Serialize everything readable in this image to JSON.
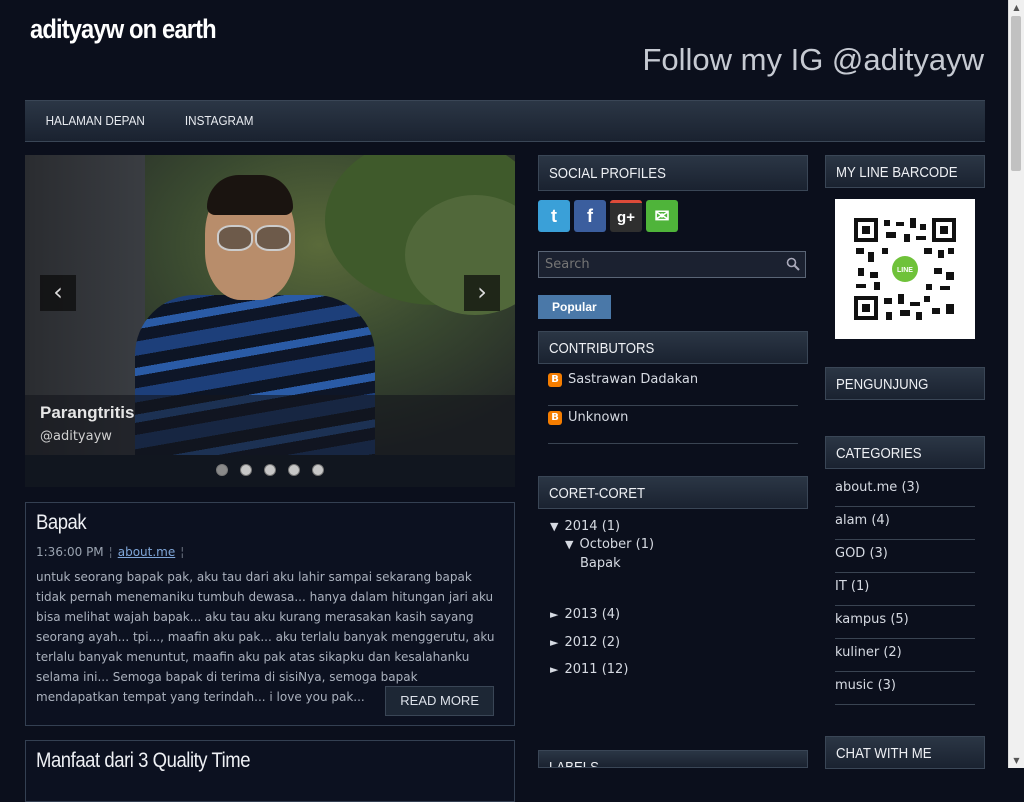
{
  "header": {
    "title": "adityayw on earth",
    "tagline": "Follow my IG @adityayw"
  },
  "nav": {
    "items": [
      "HALAMAN DEPAN",
      "INSTAGRAM"
    ]
  },
  "slider": {
    "caption_title": "Parangtritis",
    "caption_sub": "@adityayw",
    "prev": "‹",
    "next": "›",
    "dots": 5,
    "active_dot": 1
  },
  "posts": [
    {
      "title": "Bapak",
      "time": "1:36:00 PM",
      "label": "about.me",
      "excerpt": "untuk seorang bapak pak, aku tau dari aku lahir sampai sekarang bapak tidak pernah menemaniku tumbuh dewasa... hanya dalam hitungan jari aku bisa melihat wajah bapak... aku tau aku kurang merasakan kasih sayang seorang ayah... tpi..., maafin aku pak... aku terlalu banyak menggerutu, aku terlalu banyak menuntut, maafin aku pak atas sikapku dan kesalahanku selama ini... Semoga bapak di terima di sisiNya, semoga bapak mendapatkan tempat yang terindah... i love you pak...",
      "read_more": "READ MORE"
    },
    {
      "title": "Manfaat dari 3 Quality Time"
    }
  ],
  "social_profiles": {
    "title": "SOCIAL PROFILES",
    "icons": [
      {
        "name": "twitter-icon",
        "glyph": "t",
        "color": "#3aa0d8"
      },
      {
        "name": "facebook-icon",
        "glyph": "f",
        "color": "#3b5e9e"
      },
      {
        "name": "google-plus-icon",
        "glyph": "g+",
        "color": "#2f2f2f"
      },
      {
        "name": "email-icon",
        "glyph": "✉",
        "color": "#4fb43a"
      }
    ]
  },
  "search": {
    "placeholder": "Search"
  },
  "popular": {
    "label": "Popular"
  },
  "contributors": {
    "title": "CONTRIBUTORS",
    "items": [
      "Sastrawan Dadakan",
      "Unknown"
    ]
  },
  "archive": {
    "title": "CORET-CORET",
    "expanded_year": {
      "label": "2014",
      "count": "(1)"
    },
    "expanded_month": {
      "label": "October",
      "count": "(1)"
    },
    "post": "Bapak",
    "years": [
      {
        "label": "2013",
        "count": "(4)"
      },
      {
        "label": "2012",
        "count": "(2)"
      },
      {
        "label": "2011",
        "count": "(12)"
      }
    ]
  },
  "labels_widget": {
    "title": "LABELS"
  },
  "line_barcode": {
    "title": "MY LINE BARCODE",
    "logo": "LINE"
  },
  "pengunjung": {
    "title": "PENGUNJUNG"
  },
  "categories": {
    "title": "CATEGORIES",
    "items": [
      {
        "name": "about.me",
        "count": "(3)"
      },
      {
        "name": "alam",
        "count": "(4)"
      },
      {
        "name": "GOD",
        "count": "(3)"
      },
      {
        "name": "IT",
        "count": "(1)"
      },
      {
        "name": "kampus",
        "count": "(5)"
      },
      {
        "name": "kuliner",
        "count": "(2)"
      },
      {
        "name": "music",
        "count": "(3)"
      }
    ]
  },
  "chat": {
    "title": "CHAT WITH ME"
  },
  "colors": {
    "background": "#0b0f1c",
    "accent": "#4a78a8",
    "blogger": "#f57d00"
  }
}
